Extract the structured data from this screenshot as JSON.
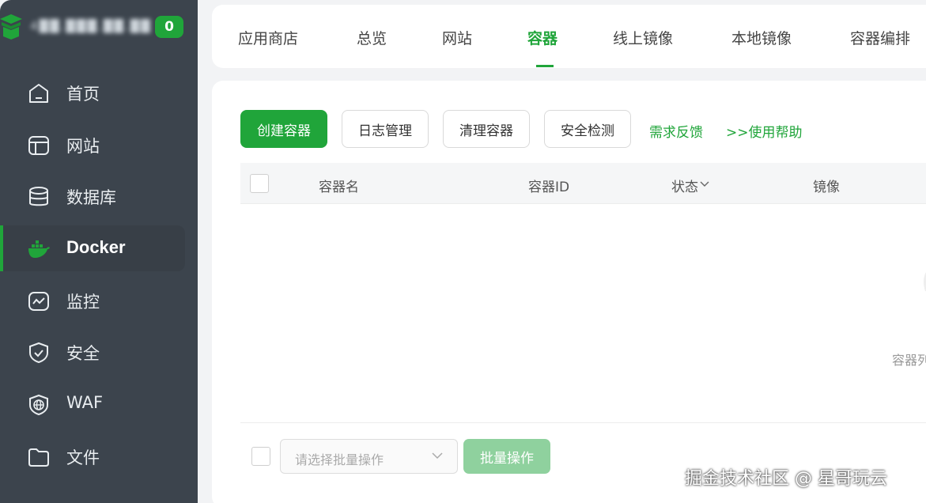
{
  "sidebar": {
    "server_ip": "4██.███.██.██",
    "badge_count": "0",
    "items": [
      {
        "label": "首页",
        "icon": "home-icon"
      },
      {
        "label": "网站",
        "icon": "website-icon"
      },
      {
        "label": "数据库",
        "icon": "database-icon"
      },
      {
        "label": "Docker",
        "icon": "docker-icon",
        "active": true
      },
      {
        "label": "监控",
        "icon": "monitor-icon"
      },
      {
        "label": "安全",
        "icon": "shield-icon"
      },
      {
        "label": "WAF",
        "icon": "waf-icon"
      },
      {
        "label": "文件",
        "icon": "folder-icon"
      }
    ]
  },
  "tabs": {
    "items": [
      "应用商店",
      "总览",
      "网站",
      "容器",
      "线上镜像",
      "本地镜像",
      "容器编排"
    ],
    "active": "容器"
  },
  "toolbar": {
    "create": "创建容器",
    "logs": "日志管理",
    "clean": "清理容器",
    "security": "安全检测",
    "feedback": "需求反馈",
    "help": ">>使用帮助"
  },
  "table": {
    "columns": [
      "容器名",
      "容器ID",
      "状态",
      "镜像"
    ],
    "empty_text": "容器列"
  },
  "footer": {
    "batch_placeholder": "请选择批量操作",
    "batch_button": "批量操作"
  },
  "watermark": "掘金技术社区 @ 星哥玩云",
  "colors": {
    "accent": "#20a53a",
    "sidebar_bg": "#3c444d",
    "batch_disabled": "#8fd19e"
  }
}
